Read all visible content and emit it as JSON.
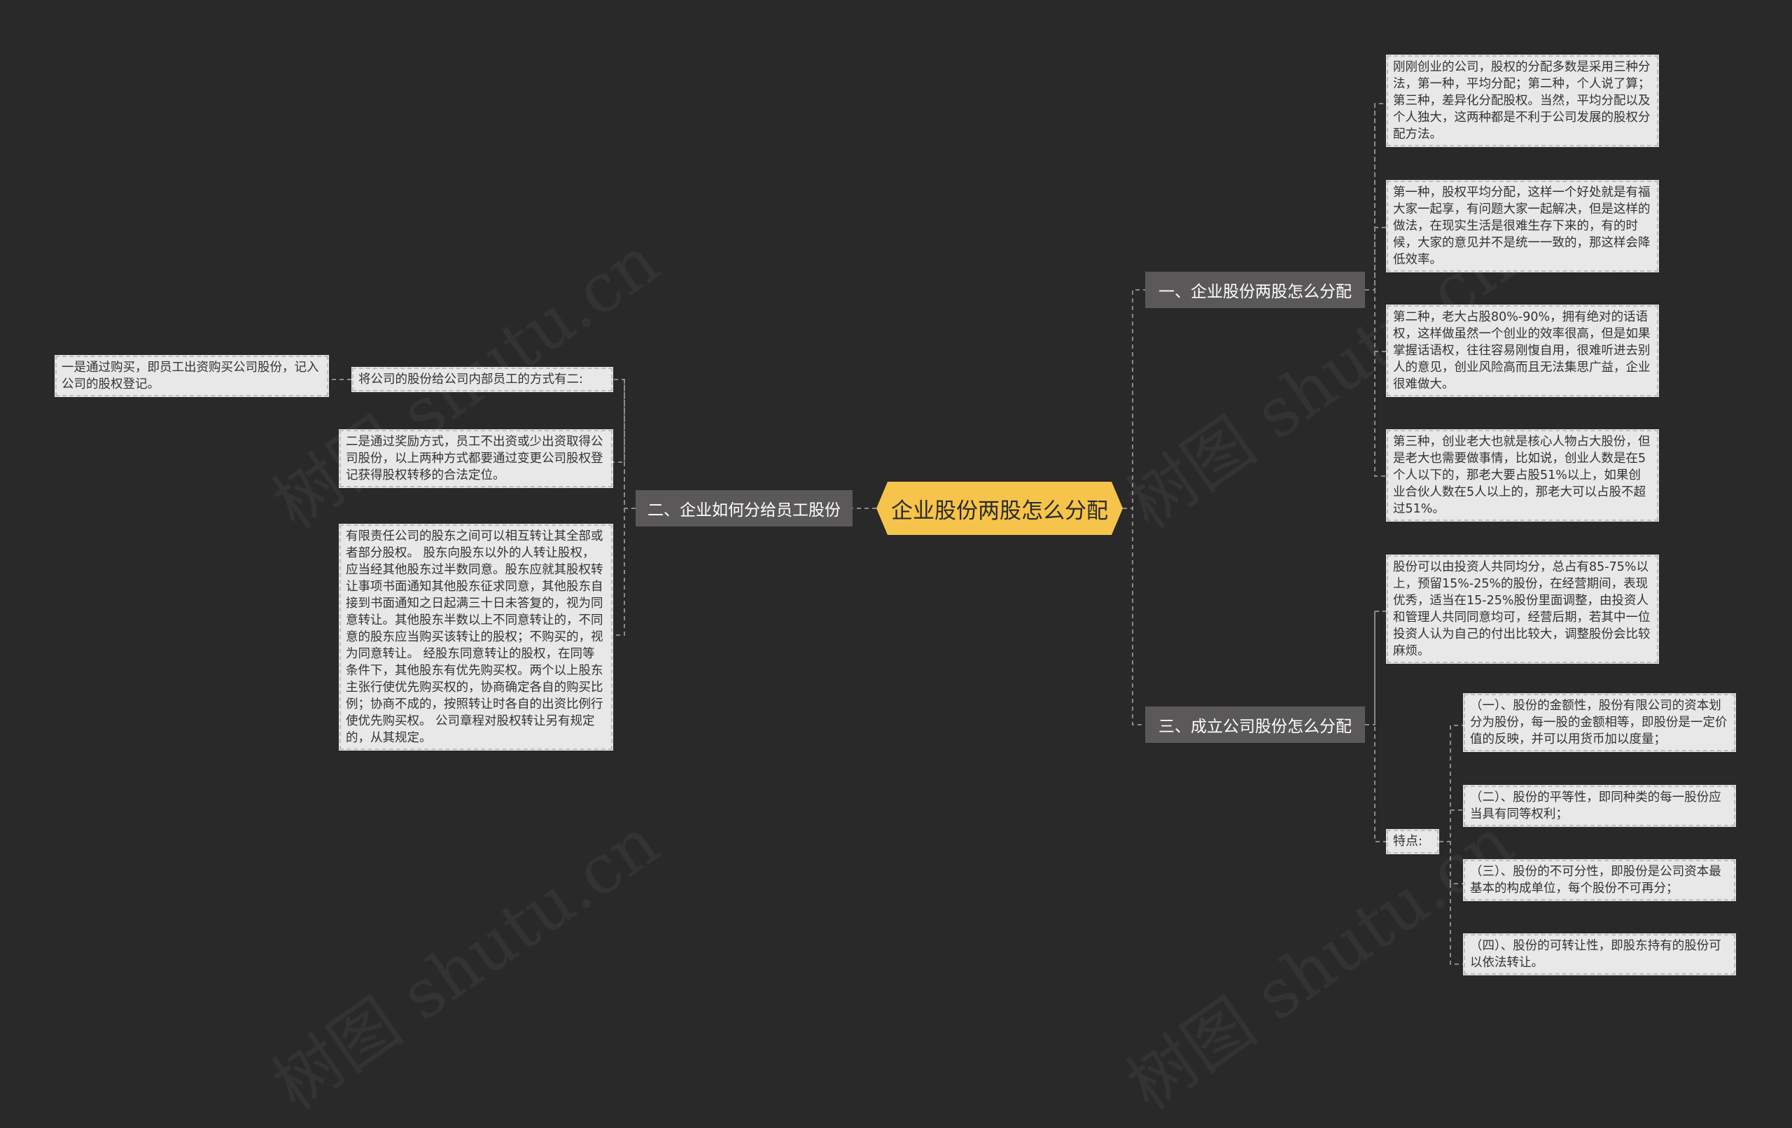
{
  "center": {
    "label": "企业股份两股怎么分配"
  },
  "branches": {
    "b1": {
      "label": "一、企业股份两股怎么分配"
    },
    "b2": {
      "label": "二、企业如何分给员工股份"
    },
    "b3": {
      "label": "三、成立公司股份怎么分配"
    }
  },
  "b1_leaves": [
    "刚刚创业的公司，股权的分配多数是采用三种分法，第一种，平均分配；第二种，个人说了算；第三种，差异化分配股权。当然，平均分配以及个人独大，这两种都是不利于公司发展的股权分配方法。",
    "第一种，股权平均分配，这样一个好处就是有福大家一起享，有问题大家一起解决，但是这样的做法，在现实生活是很难生存下来的，有的时候，大家的意见并不是统一一致的，那这样会降低效率。",
    "第二种，老大占股80%-90%，拥有绝对的话语权，这样做虽然一个创业的效率很高，但是如果掌握话语权，往往容易刚愎自用，很难听进去别人的意见，创业风险高而且无法集思广益，企业很难做大。",
    "第三种，创业老大也就是核心人物占大股份，但是老大也需要做事情，比如说，创业人数是在5个人以下的，那老大要占股51%以上，如果创业合伙人数在5人以上的，那老大可以占股不超过51%。"
  ],
  "b2_children": {
    "methods_intro": "将公司的股份给公司内部员工的方式有二:",
    "method1": "一是通过购买，即员工出资购买公司股份，记入公司的股权登记。",
    "method2": "二是通过奖励方式，员工不出资或少出资取得公司股份，以上两种方式都要通过变更公司股权登记获得股权转移的合法定位。",
    "transfer": "有限责任公司的股东之间可以相互转让其全部或者部分股权。 股东向股东以外的人转让股权，应当经其他股东过半数同意。股东应就其股权转让事项书面通知其他股东征求同意，其他股东自接到书面通知之日起满三十日未答复的，视为同意转让。其他股东半数以上不同意转让的，不同意的股东应当购买该转让的股权；不购买的，视为同意转让。 经股东同意转让的股权，在同等条件下，其他股东有优先购买权。两个以上股东主张行使优先购买权的，协商确定各自的购买比例；协商不成的，按照转让时各自的出资比例行使优先购买权。 公司章程对股权转让另有规定的，从其规定。"
  },
  "b3_children": {
    "allocation": "股份可以由投资人共同均分，总占有85-75%以上，预留15%-25%的股份，在经营期间，表现优秀，适当在15-25%股份里面调整，由投资人和管理人共同同意均可，经营后期，若其中一位投资人认为自己的付出比较大，调整股份会比较麻烦。",
    "features_label": "特点:",
    "features": [
      "（一）、股份的金额性，股份有限公司的资本划分为股份，每一股的金额相等，即股份是一定价值的反映，并可以用货币加以度量；",
      "（二）、股份的平等性，即同种类的每一股份应当具有同等权利；",
      "（三）、股份的不可分性，即股份是公司资本最基本的构成单位，每个股份不可再分；",
      "（四）、股份的可转让性，即股东持有的股份可以依法转让。"
    ]
  },
  "watermark": "树图 shutu.cn",
  "colors": {
    "background": "#292929",
    "center": "#f6c44a",
    "branch": "#5a5858",
    "leaf": "#e8e8e8",
    "line": "#8a8a8a"
  }
}
